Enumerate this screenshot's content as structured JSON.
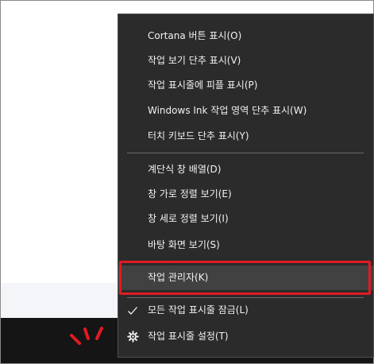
{
  "context_menu": {
    "items": [
      {
        "label": "Cortana 버튼 표시(O)"
      },
      {
        "label": "작업 보기 단추 표시(V)"
      },
      {
        "label": "작업 표시줄에 피플 표시(P)"
      },
      {
        "label": "Windows Ink 작업 영역 단추 표시(W)"
      },
      {
        "label": "터치 키보드 단추 표시(Y)"
      },
      {
        "label": "계단식 창 배열(D)"
      },
      {
        "label": "창 가로 정렬 보기(E)"
      },
      {
        "label": "창 세로 정렬 보기(I)"
      },
      {
        "label": "바탕 화면 보기(S)"
      },
      {
        "label": "작업 관리자(K)",
        "highlighted": true
      },
      {
        "label": "모든 작업 표시줄 잠금(L)",
        "icon": "checkmark-icon",
        "checked": true
      },
      {
        "label": "작업 표시줄 설정(T)",
        "icon": "gear-icon"
      }
    ]
  },
  "colors": {
    "menu_background": "#2b2b2b",
    "menu_text": "#f2f2f2",
    "highlight": "#414141",
    "annotation_red": "#e01b24",
    "taskbar": "#151515"
  }
}
